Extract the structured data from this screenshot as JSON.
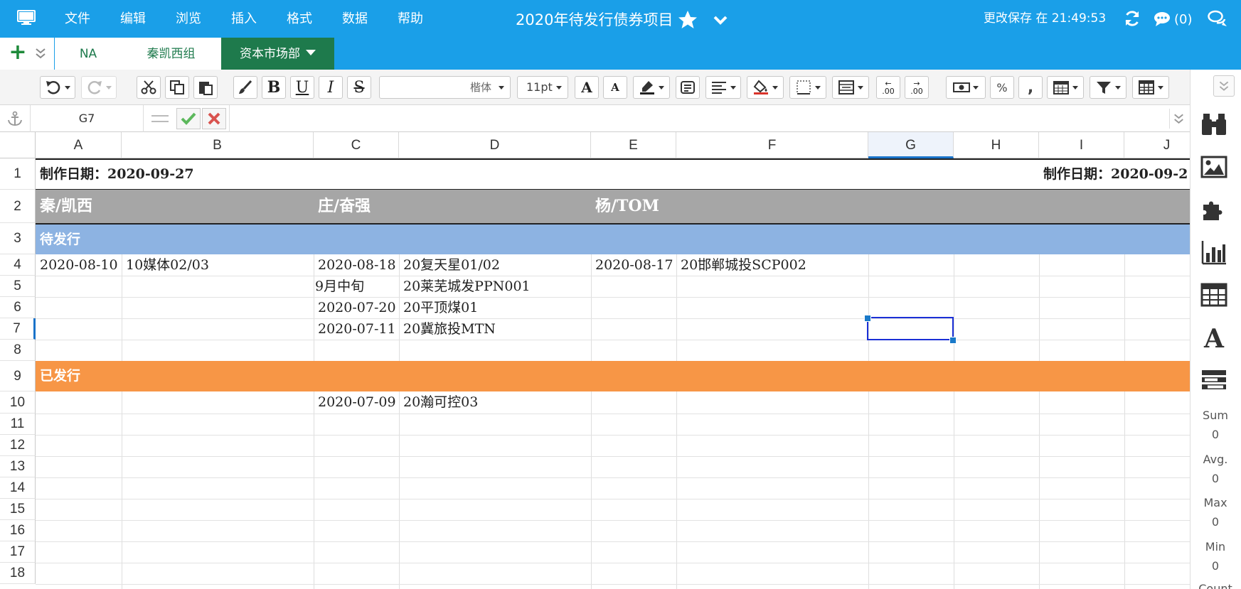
{
  "menu": [
    "文件",
    "编辑",
    "浏览",
    "插入",
    "格式",
    "数据",
    "帮助"
  ],
  "doc_title": "2020年待发行债券项目",
  "save_status": "更改保存 在 21:49:53",
  "comments_count": "(0)",
  "sheet_tabs": [
    {
      "label": "NA",
      "active": false
    },
    {
      "label": "秦凯西组",
      "active": false
    },
    {
      "label": "资本市场部",
      "active": true
    }
  ],
  "toolbar": {
    "font_name": "楷体",
    "font_size": "11pt",
    "decimal_decrease": ".00",
    "decimal_increase": ".00",
    "percent": "%",
    "comma": ","
  },
  "formula_bar": {
    "cell_ref": "G7",
    "value": ""
  },
  "columns": [
    "A",
    "B",
    "C",
    "D",
    "E",
    "F",
    "G",
    "H",
    "I",
    "J"
  ],
  "selected_column": "G",
  "selected_row": "7",
  "rows": [
    "1",
    "2",
    "3",
    "4",
    "5",
    "6",
    "7",
    "8",
    "9",
    "10",
    "11",
    "12",
    "13",
    "14",
    "15",
    "16",
    "17",
    "18"
  ],
  "cells": {
    "r1_a": "制作日期：2020-09-27",
    "r1_i": "制作日期：2020-09-2",
    "r2_a": "秦/凯西",
    "r2_c": "庄/奋强",
    "r2_e": "杨/TOM",
    "r3_a": "待发行",
    "r4_a": "2020-08-10",
    "r4_b": "10媒体02/03",
    "r4_c": "2020-08-18",
    "r4_d": "20复天星01/02",
    "r4_e": "2020-08-17",
    "r4_f": "20邯郸城投SCP002",
    "r5_c": "9月中旬",
    "r5_d": "20莱芜城发PPN001",
    "r6_c": "2020-07-20",
    "r6_d": "20平顶煤01",
    "r7_c": "2020-07-11",
    "r7_d": "20冀旅投MTN",
    "r9_a": "已发行",
    "r10_c": "2020-07-09",
    "r10_d": "20瀚可控03"
  },
  "status": {
    "sum_label": "Sum",
    "sum_value": "0",
    "avg_label": "Avg.",
    "avg_value": "0",
    "max_label": "Max",
    "max_value": "0",
    "min_label": "Min",
    "min_value": "0",
    "count_label": "Count"
  },
  "colors": {
    "topbar": "#1a9fe8",
    "active_tab": "#1e7a4c",
    "header_gray": "#a6a6a6",
    "pending_blue": "#8db3e2",
    "issued_orange": "#f79646",
    "selection": "#1a2fd6"
  }
}
